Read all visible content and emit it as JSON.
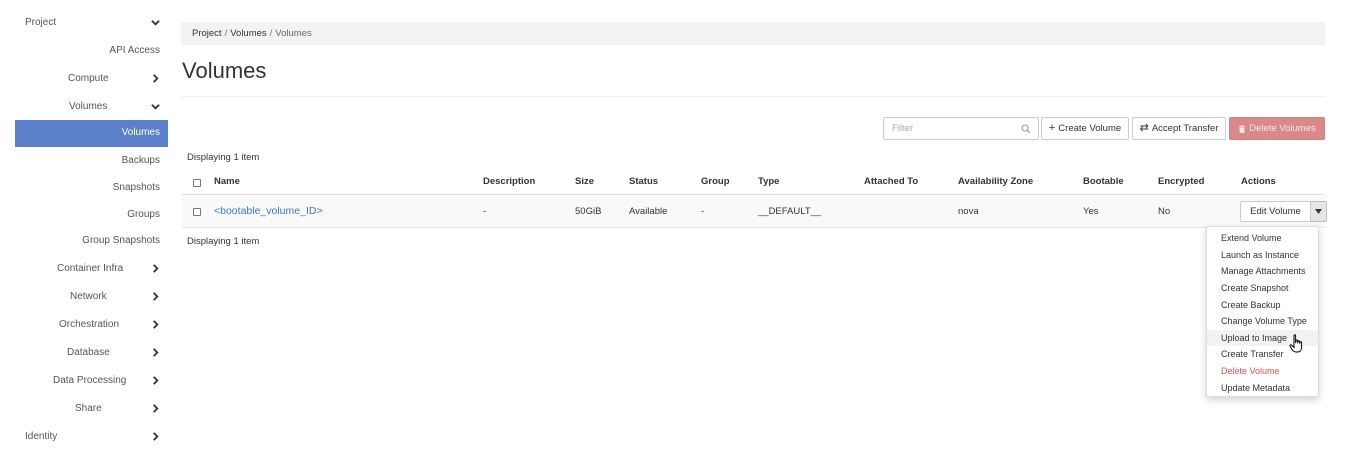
{
  "sidebar": {
    "project": "Project",
    "api_access": "API Access",
    "compute": "Compute",
    "volumes_group": "Volumes",
    "volumes_active": "Volumes",
    "backups": "Backups",
    "snapshots": "Snapshots",
    "groups": "Groups",
    "group_snapshots": "Group Snapshots",
    "container_infra": "Container Infra",
    "network": "Network",
    "orchestration": "Orchestration",
    "database": "Database",
    "data_processing": "Data Processing",
    "share": "Share",
    "identity": "Identity"
  },
  "breadcrumb": {
    "items": [
      "Project",
      "Volumes",
      "Volumes"
    ],
    "separator": "/"
  },
  "page": {
    "title": "Volumes"
  },
  "toolbar": {
    "filter_placeholder": "Filter",
    "create_volume": "Create Volume",
    "accept_transfer": "Accept Transfer",
    "delete_volumes": "Delete Volumes"
  },
  "table": {
    "displaying": "Displaying 1 item",
    "columns": [
      "Name",
      "Description",
      "Size",
      "Status",
      "Group",
      "Type",
      "Attached To",
      "Availability Zone",
      "Bootable",
      "Encrypted",
      "Actions"
    ],
    "rows": [
      {
        "name": "<bootable_volume_ID>",
        "description": "-",
        "size": "50GiB",
        "status": "Available",
        "group": "-",
        "type": "__DEFAULT__",
        "attached_to": "",
        "availability_zone": "nova",
        "bootable": "Yes",
        "encrypted": "No",
        "action": "Edit Volume"
      }
    ]
  },
  "action_menu": {
    "items": [
      "Extend Volume",
      "Launch as Instance",
      "Manage Attachments",
      "Create Snapshot",
      "Create Backup",
      "Change Volume Type",
      "Upload to Image",
      "Create Transfer",
      "Delete Volume",
      "Update Metadata"
    ],
    "hovered": "Upload to Image",
    "danger": "Delete Volume"
  },
  "colors": {
    "active": "#5b80c9",
    "link": "#3c7abb",
    "danger_button": "#d9898a",
    "danger_text": "#d9534f"
  }
}
